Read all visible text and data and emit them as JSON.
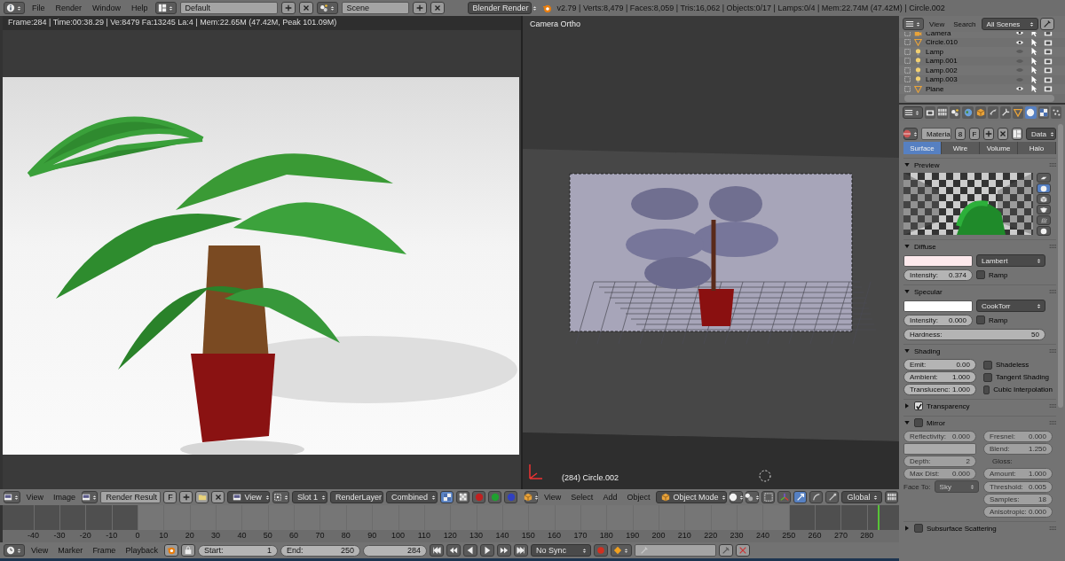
{
  "top_bar": {
    "menus": [
      "File",
      "Render",
      "Window",
      "Help"
    ],
    "screen_layout": "Default",
    "scene": "Scene",
    "engine": "Blender Render",
    "stats": "v2.79 | Verts:8,479 | Faces:8,059 | Tris:16,062 | Objects:0/17 | Lamps:0/4 | Mem:22.74M (47.42M) | Circle.002"
  },
  "image_editor": {
    "render_info": "Frame:284 | Time:00:38.29 | Ve:8479 Fa:13245 La:4 | Mem:22.65M (47.42M, Peak 101.09M)",
    "header": {
      "menus": [
        "View",
        "Image"
      ],
      "image": "Render Result",
      "fake_user": "F",
      "view": "View",
      "slot": "Slot 1",
      "layer": "RenderLayer",
      "pass": "Combined"
    }
  },
  "viewport": {
    "label": "Camera Ortho",
    "object_info": "(284) Circle.002",
    "header": {
      "menus": [
        "View",
        "Select",
        "Add",
        "Object"
      ],
      "mode": "Object Mode",
      "orientation": "Global"
    }
  },
  "timeline": {
    "ruler_labels": [
      "-40",
      "-30",
      "-20",
      "-10",
      "0",
      "10",
      "20",
      "30",
      "40",
      "50",
      "60",
      "70",
      "80",
      "90",
      "100",
      "110",
      "120",
      "130",
      "140",
      "150",
      "160",
      "170",
      "180",
      "190",
      "200",
      "210",
      "220",
      "230",
      "240",
      "250",
      "260",
      "270",
      "280"
    ],
    "header": {
      "menus": [
        "View",
        "Marker",
        "Frame",
        "Playback"
      ],
      "start": {
        "label": "Start:",
        "value": "1"
      },
      "end": {
        "label": "End:",
        "value": "250"
      },
      "current": "284",
      "sync": "No Sync"
    }
  },
  "outliner": {
    "menus": [
      "View",
      "Search"
    ],
    "scenes": "All Scenes",
    "items": [
      {
        "name": "Camera",
        "kind": "camera",
        "visible": true
      },
      {
        "name": "Circle.010",
        "kind": "mesh",
        "visible": true
      },
      {
        "name": "Lamp",
        "kind": "lamp",
        "visible": false
      },
      {
        "name": "Lamp.001",
        "kind": "lamp",
        "visible": false
      },
      {
        "name": "Lamp.002",
        "kind": "lamp",
        "visible": false
      },
      {
        "name": "Lamp.003",
        "kind": "lamp",
        "visible": false
      },
      {
        "name": "Plane",
        "kind": "mesh",
        "visible": true
      }
    ]
  },
  "properties": {
    "context_tabs": [
      {
        "kind": "render",
        "selected": false
      },
      {
        "kind": "layers",
        "selected": false
      },
      {
        "kind": "scene",
        "selected": false
      },
      {
        "kind": "world",
        "selected": false
      },
      {
        "kind": "object",
        "selected": false
      },
      {
        "kind": "constraints",
        "selected": false
      },
      {
        "kind": "modifiers",
        "selected": false
      },
      {
        "kind": "data",
        "selected": false
      },
      {
        "kind": "material",
        "selected": true
      },
      {
        "kind": "texture",
        "selected": false
      },
      {
        "kind": "particles",
        "selected": false
      }
    ],
    "material": {
      "name": "Materia",
      "users": "8",
      "fake_user": "F",
      "link": "Data"
    },
    "type_tabs": [
      {
        "label": "Surface",
        "selected": true
      },
      {
        "label": "Wire",
        "selected": false
      },
      {
        "label": "Volume",
        "selected": false
      },
      {
        "label": "Halo",
        "selected": false
      }
    ],
    "preview": {
      "title": "Preview",
      "expanded": true,
      "shapes": [
        {
          "selected": false
        },
        {
          "selected": true
        },
        {
          "selected": false
        },
        {
          "selected": false
        },
        {
          "selected": false
        },
        {
          "selected": false
        }
      ]
    },
    "diffuse": {
      "title": "Diffuse",
      "expanded": true,
      "shader": "Lambert",
      "intensity": {
        "label": "Intensity:",
        "value": "0.374"
      },
      "ramp": {
        "label": "Ramp",
        "checked": false
      }
    },
    "specular": {
      "title": "Specular",
      "expanded": true,
      "shader": "CookTorr",
      "intensity": {
        "label": "Intensity:",
        "value": "0.000"
      },
      "ramp": {
        "label": "Ramp",
        "checked": false
      },
      "hardness": {
        "label": "Hardness:",
        "value": "50"
      }
    },
    "shading": {
      "title": "Shading",
      "expanded": true,
      "fields": [
        {
          "label": "Emit:",
          "value": "0.00"
        },
        {
          "label": "Ambient:",
          "value": "1.000"
        },
        {
          "label": "Translucenc:",
          "value": "1.000"
        }
      ],
      "options": [
        {
          "label": "Shadeless",
          "checked": false
        },
        {
          "label": "Tangent Shading",
          "checked": false
        },
        {
          "label": "Cubic Interpolation",
          "checked": false
        }
      ]
    },
    "transparency": {
      "title": "Transparency",
      "expanded": false,
      "checked": true
    },
    "mirror": {
      "title": "Mirror",
      "expanded": true,
      "checked": false,
      "reflectivity": {
        "label": "Reflectivity:",
        "value": "0.000"
      },
      "fresnel": {
        "label": "Fresnel:",
        "value": "0.000"
      },
      "blend": {
        "label": "Blend:",
        "value": "1.250"
      },
      "depth": {
        "label": "Depth:",
        "value": "2"
      },
      "max_dist": {
        "label": "Max Dist:",
        "value": "0.000"
      },
      "face_to": {
        "label": "Face To:",
        "value": "Sky"
      },
      "gloss": {
        "label": "Gloss:",
        "fields": [
          {
            "label": "Amount:",
            "value": "1.000"
          },
          {
            "label": "Threshold:",
            "value": "0.005"
          },
          {
            "label": "Samples:",
            "value": "18"
          },
          {
            "label": "Anisotropic:",
            "value": "0.000"
          }
        ]
      }
    },
    "sss": {
      "title": "Subsurface Scattering",
      "expanded": false,
      "checked": false
    }
  }
}
